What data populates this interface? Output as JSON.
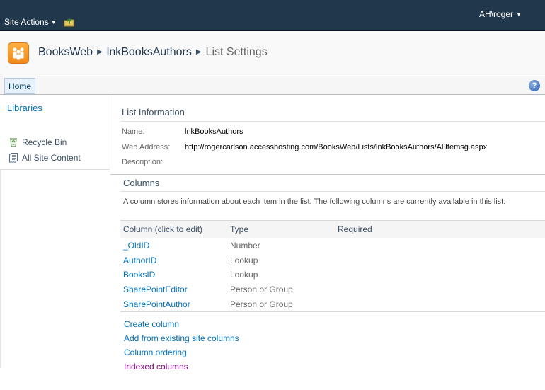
{
  "topbar": {
    "site_actions": "Site Actions",
    "user": "AH\\roger"
  },
  "breadcrumb": {
    "site": "BooksWeb",
    "list": "lnkBooksAuthors",
    "page": "List Settings"
  },
  "tabs": {
    "home": "Home"
  },
  "help": {
    "glyph": "?"
  },
  "leftnav": {
    "libraries": "Libraries",
    "items": [
      {
        "label": "Recycle Bin",
        "icon": "recycle-bin-icon"
      },
      {
        "label": "All Site Content",
        "icon": "site-content-icon"
      }
    ]
  },
  "list_information": {
    "title": "List Information",
    "name_label": "Name:",
    "name_value": "lnkBooksAuthors",
    "address_label": "Web Address:",
    "address_value": "http://rogercarlson.accesshosting.com/BooksWeb/Lists/lnkBooksAuthors/AllItemsg.aspx",
    "description_label": "Description:"
  },
  "columns": {
    "title": "Columns",
    "description": "A column stores information about each item in the list. The following columns are currently available in this list:",
    "headers": {
      "column": "Column (click to edit)",
      "type": "Type",
      "required": "Required"
    },
    "rows": [
      {
        "name": "_OldID",
        "type": "Number"
      },
      {
        "name": "AuthorID",
        "type": "Lookup"
      },
      {
        "name": "BooksID",
        "type": "Lookup"
      },
      {
        "name": "SharePointEditor",
        "type": "Person or Group"
      },
      {
        "name": "SharePointAuthor",
        "type": "Person or Group"
      }
    ],
    "actions": [
      "Create column",
      "Add from existing site columns",
      "Column ordering",
      "Indexed columns"
    ]
  },
  "colors": {
    "topbar": "#21374c",
    "link": "#0072bc",
    "visited_link": "#800080",
    "logo": "#f08a1c"
  }
}
